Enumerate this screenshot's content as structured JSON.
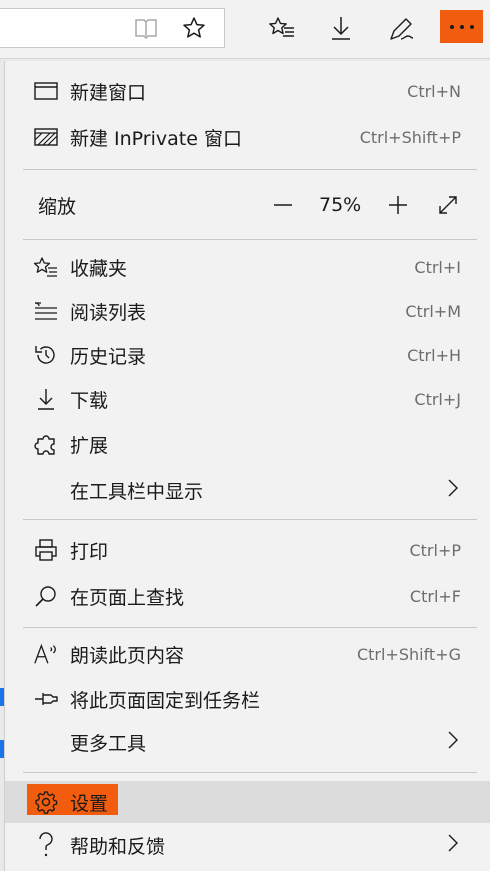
{
  "menu": {
    "new_window": {
      "label": "新建窗口",
      "shortcut": "Ctrl+N"
    },
    "new_inprivate": {
      "label": "新建 InPrivate 窗口",
      "shortcut": "Ctrl+Shift+P"
    },
    "zoom": {
      "label": "缩放",
      "value": "75%"
    },
    "favorites": {
      "label": "收藏夹",
      "shortcut": "Ctrl+I"
    },
    "reading_list": {
      "label": "阅读列表",
      "shortcut": "Ctrl+M"
    },
    "history": {
      "label": "历史记录",
      "shortcut": "Ctrl+H"
    },
    "downloads": {
      "label": "下载",
      "shortcut": "Ctrl+J"
    },
    "extensions": {
      "label": "扩展"
    },
    "show_in_toolbar": {
      "label": "在工具栏中显示"
    },
    "print": {
      "label": "打印",
      "shortcut": "Ctrl+P"
    },
    "find": {
      "label": "在页面上查找",
      "shortcut": "Ctrl+F"
    },
    "read_aloud": {
      "label": "朗读此页内容",
      "shortcut": "Ctrl+Shift+G"
    },
    "pin_taskbar": {
      "label": "将此页面固定到任务栏"
    },
    "more_tools": {
      "label": "更多工具"
    },
    "settings": {
      "label": "设置"
    },
    "help": {
      "label": "帮助和反馈"
    }
  },
  "colors": {
    "accent": "#f25c0f",
    "menu_bg": "#f2f2f2",
    "separator": "#c8c8c8",
    "shortcut_text": "#6d6d6d"
  },
  "icons": [
    "reading-view-icon",
    "favorite-star-icon",
    "favorites-hub-icon",
    "download-icon",
    "web-note-icon",
    "more-dots-icon"
  ]
}
